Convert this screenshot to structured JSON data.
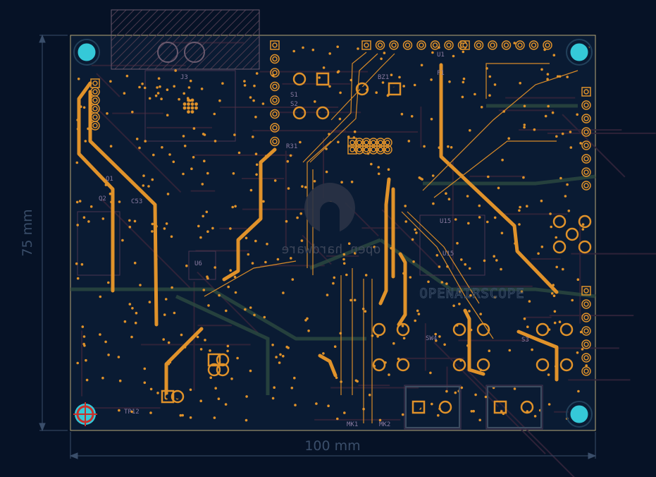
{
  "board": {
    "width_label": "100 mm",
    "height_label": "75 mm",
    "logo_text": "open hardware",
    "project_text": "OPENAIRSCOPE",
    "silkscreen_labels": [
      "U15",
      "U15",
      "U6",
      "S1",
      "S2",
      "SW4",
      "S3",
      "TP12",
      "MK1",
      "MK2",
      "BZ1",
      "J3",
      "U1",
      "Q2",
      "Q1",
      "C53",
      "R31",
      "F1"
    ]
  },
  "colors": {
    "background": "#061226",
    "board": "#0a1b33",
    "copper": "#e0922a",
    "mounting_hole": "#35c9d8",
    "outline": "#b8a878",
    "inner_trace": "#3d2a3a",
    "dimension": "#3a4e6a"
  }
}
